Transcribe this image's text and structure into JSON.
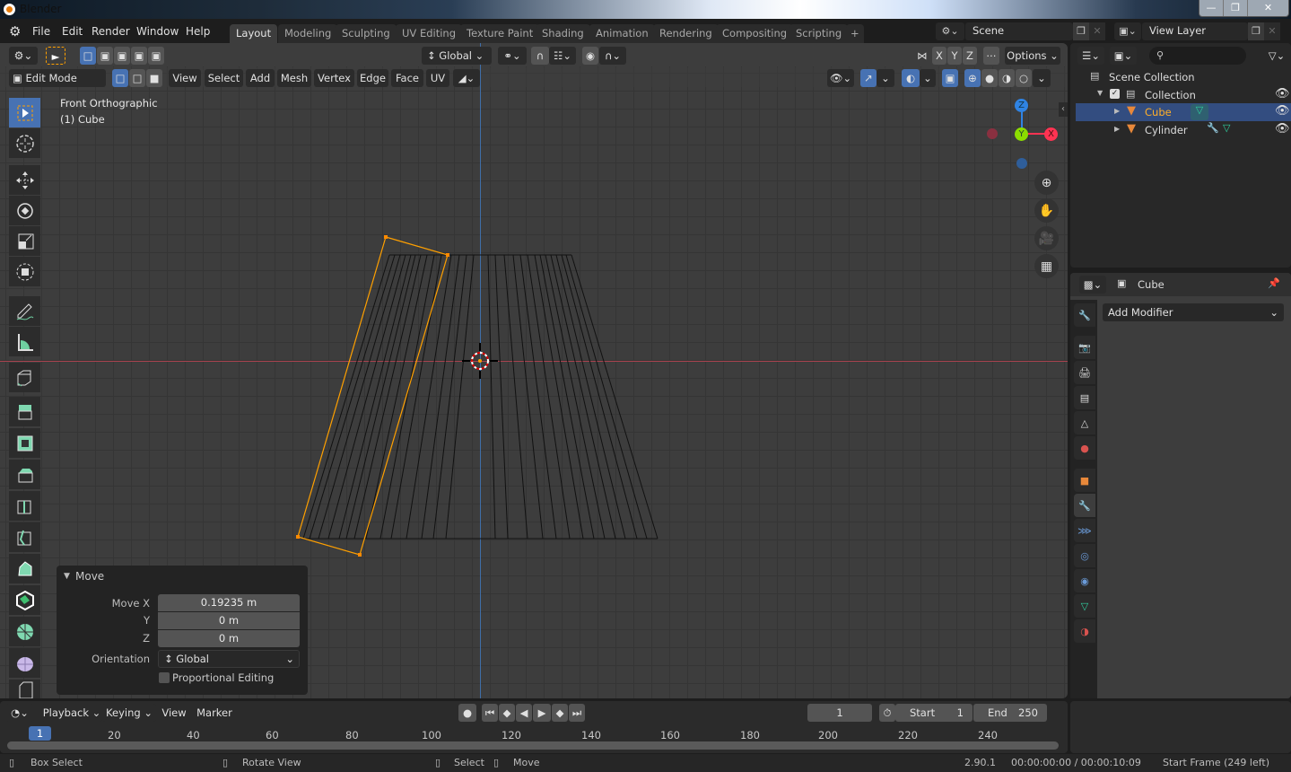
{
  "window": {
    "title": "Blender",
    "controls": [
      "minimize",
      "maximize",
      "close"
    ]
  },
  "menubar": {
    "items": [
      "File",
      "Edit",
      "Render",
      "Window",
      "Help"
    ]
  },
  "workspaces": {
    "tabs": [
      "Layout",
      "Modeling",
      "Sculpting",
      "UV Editing",
      "Texture Paint",
      "Shading",
      "Animation",
      "Rendering",
      "Compositing",
      "Scripting"
    ],
    "active": "Layout",
    "add_label": "+"
  },
  "scene": {
    "name": "Scene",
    "view_layer": "View Layer"
  },
  "tool_header": {
    "orientation": "Global",
    "axes": [
      "X",
      "Y",
      "Z"
    ],
    "options_label": "Options"
  },
  "view_header": {
    "mode": "Edit Mode",
    "menus": [
      "View",
      "Select",
      "Add",
      "Mesh",
      "Vertex",
      "Edge",
      "Face",
      "UV"
    ]
  },
  "viewport": {
    "view_name": "Front Orthographic",
    "object_label": "(1) Cube",
    "gizmo": {
      "z": "Z",
      "y": "Y",
      "x": "X"
    },
    "colors": {
      "x_axis": "#ff3352",
      "y_axis": "#8bdc00",
      "z_axis": "#2f83e3",
      "selection": "#ffa000"
    }
  },
  "toolbar": {
    "tools": [
      "select-box",
      "cursor",
      "move",
      "rotate",
      "scale",
      "transform",
      "annotate",
      "measure",
      "add-cube",
      "extrude",
      "inset",
      "bevel",
      "loop-cut",
      "knife",
      "poly-build",
      "spin",
      "smooth",
      "shrink-fatten",
      "shear"
    ]
  },
  "move_panel": {
    "title": "Move",
    "fields": [
      {
        "label": "Move X",
        "value": "0.19235 m"
      },
      {
        "label": "Y",
        "value": "0 m"
      },
      {
        "label": "Z",
        "value": "0 m"
      }
    ],
    "orientation_label": "Orientation",
    "orientation_value": "Global",
    "proportional_label": "Proportional Editing",
    "proportional_checked": false
  },
  "outliner": {
    "search_placeholder": "",
    "root": "Scene Collection",
    "collection": "Collection",
    "items": [
      {
        "name": "Cube",
        "selected": true
      },
      {
        "name": "Cylinder",
        "selected": false
      }
    ]
  },
  "properties": {
    "object_name": "Cube",
    "add_modifier_label": "Add Modifier",
    "tabs": [
      "tool",
      "render",
      "output",
      "view-layer",
      "scene",
      "world",
      "object",
      "modifiers",
      "particles",
      "physics",
      "constraints",
      "data",
      "material"
    ],
    "active_tab": "modifiers"
  },
  "timeline": {
    "menus": [
      "Playback",
      "Keying",
      "View",
      "Marker"
    ],
    "current_frame": "1",
    "start_label": "Start",
    "start_value": "1",
    "end_label": "End",
    "end_value": "250",
    "ticks": [
      "20",
      "40",
      "60",
      "80",
      "100",
      "120",
      "140",
      "160",
      "180",
      "200",
      "220",
      "240"
    ],
    "playhead": "1"
  },
  "statusbar": {
    "left": [
      "Box Select",
      "Rotate View"
    ],
    "middle": [
      "Select",
      "Move"
    ],
    "version": "2.90.1",
    "time": "00:00:00:00 / 00:00:10:09",
    "info": "Start Frame (249 left)"
  }
}
